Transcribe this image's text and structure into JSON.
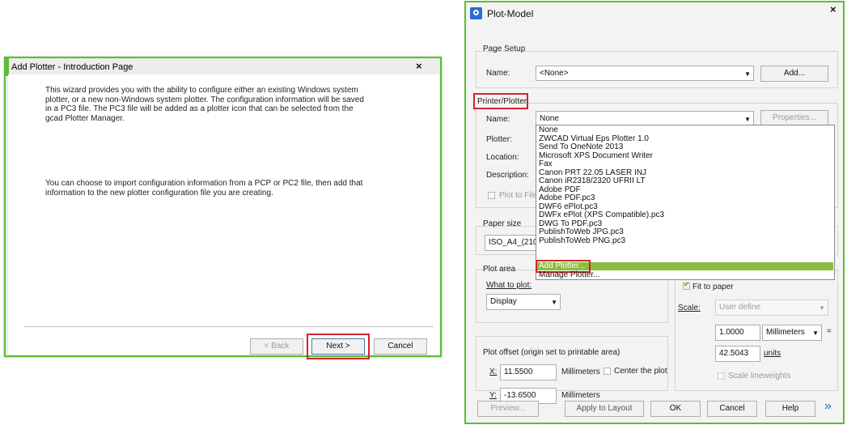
{
  "wizard": {
    "title": "Add Plotter - Introduction Page",
    "close": "×",
    "para1": "This wizard provides you with the ability to configure either an existing Windows system plotter, or a new non-Windows system plotter. The configuration information will be saved in a PC3 file. The PC3 file will be added as a plotter icon that can be selected from the gcad Plotter Manager.",
    "para2": "You can choose to import configuration information from a PCP or PC2 file, then add that information to the new plotter configuration file you are creating.",
    "back_label": "< Back",
    "next_label": "Next >",
    "cancel_label": "Cancel"
  },
  "plot": {
    "title": "Plot-Model",
    "close": "×",
    "page_setup": {
      "group_label": "Page Setup",
      "name_label": "Name:",
      "name_value": "<None>",
      "add_label": "Add..."
    },
    "printer": {
      "group_label": "Printer/Plotter",
      "name_label": "Name:",
      "name_value": "None",
      "properties_label": "Properties...",
      "plotter_label": "Plotter:",
      "location_label": "Location:",
      "description_label": "Description:",
      "plot_to_file_label": "Plot to File",
      "options": [
        "None",
        "ZWCAD Virtual Eps Plotter 1.0",
        "Send To OneNote 2013",
        "Microsoft XPS Document Writer",
        "Fax",
        "Canon PRT 22.05 LASER INJ",
        "Canon iR2318/2320 UFRII LT",
        "Adobe PDF",
        "Adobe PDF.pc3",
        "DWF6 ePlot.pc3",
        "DWFx ePlot (XPS Compatible).pc3",
        "DWG To PDF.pc3",
        "PublishToWeb JPG.pc3",
        "PublishToWeb PNG.pc3",
        "Add Plotter...",
        "Manage Plotter..."
      ]
    },
    "paper_size": {
      "group_label": "Paper size",
      "value": "ISO_A4_(210"
    },
    "plot_area": {
      "group_label": "Plot area",
      "what_label": "What to plot:",
      "what_value": "Display"
    },
    "plot_scale": {
      "fit_label": "Fit to paper",
      "scale_label": "Scale:",
      "scale_value": "User define",
      "value1": "1.0000",
      "unit1": "Millimeters",
      "equals": "=",
      "value2": "42.5043",
      "unit2": "units",
      "lineweights_label": "Scale lineweights"
    },
    "offset": {
      "group_label": "Plot offset (origin set to printable area)",
      "x_label": "X:",
      "x_value": "11.5500",
      "x_unit": "Millimeters",
      "center_label": "Center the plot",
      "y_label": "Y:",
      "y_value": "-13.6500",
      "y_unit": "Millimeters"
    },
    "buttons": {
      "preview": "Preview...",
      "apply": "Apply to Layout",
      "ok": "OK",
      "cancel": "Cancel",
      "help": "Help",
      "more": "»"
    }
  }
}
